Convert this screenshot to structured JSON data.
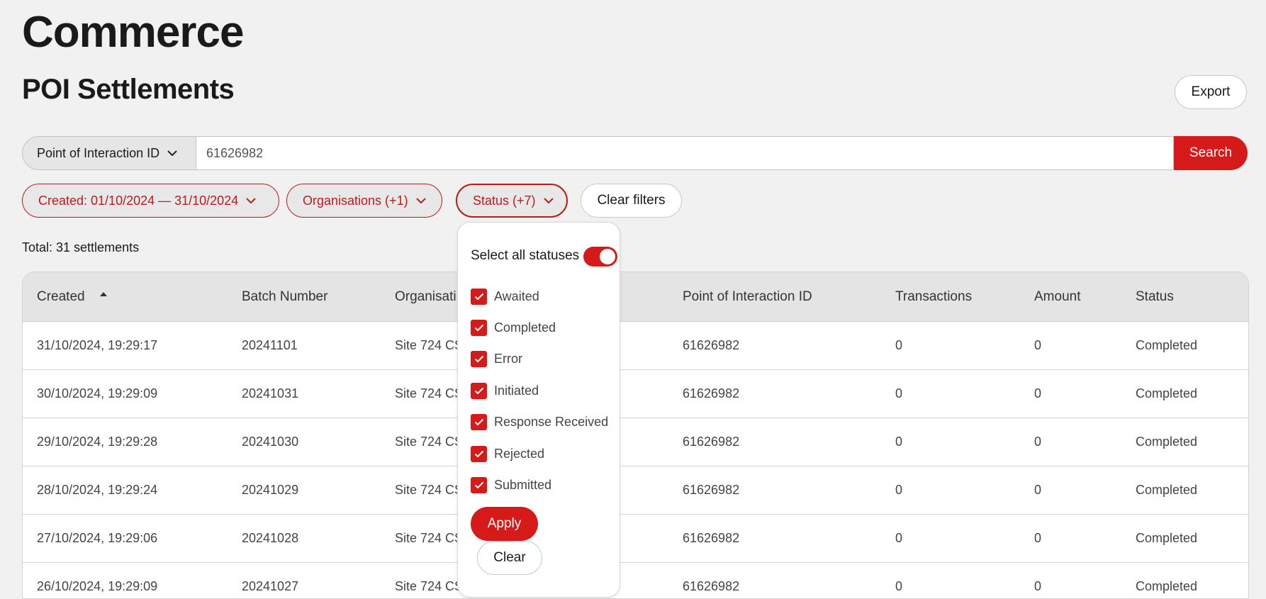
{
  "app": {
    "title": "Commerce"
  },
  "page": {
    "title": "POI Settlements",
    "export_label": "Export"
  },
  "search": {
    "field_label": "Point of Interaction ID",
    "value": "61626982",
    "button_label": "Search"
  },
  "filters": {
    "created_label": "Created: 01/10/2024 — 31/10/2024",
    "organisations_label": "Organisations (+1)",
    "status_label": "Status (+7)",
    "clear_label": "Clear filters"
  },
  "total_label": "Total: 31 settlements",
  "table": {
    "columns": [
      "Created",
      "Batch Number",
      "Organisati",
      "Point of Interaction ID",
      "Transactions",
      "Amount",
      "Status"
    ],
    "rows": [
      [
        "31/10/2024, 19:29:17",
        "20241101",
        "Site 724 CS",
        "61626982",
        "0",
        "0",
        "Completed"
      ],
      [
        "30/10/2024, 19:29:09",
        "20241031",
        "Site 724 CS",
        "61626982",
        "0",
        "0",
        "Completed"
      ],
      [
        "29/10/2024, 19:29:28",
        "20241030",
        "Site 724 CS",
        "61626982",
        "0",
        "0",
        "Completed"
      ],
      [
        "28/10/2024, 19:29:24",
        "20241029",
        "Site 724 CS",
        "61626982",
        "0",
        "0",
        "Completed"
      ],
      [
        "27/10/2024, 19:29:06",
        "20241028",
        "Site 724 CS",
        "61626982",
        "0",
        "0",
        "Completed"
      ],
      [
        "26/10/2024, 19:29:09",
        "20241027",
        "Site 724 CS",
        "61626982",
        "0",
        "0",
        "Completed"
      ]
    ]
  },
  "status_dropdown": {
    "select_all_label": "Select all statuses",
    "select_all_on": true,
    "options": [
      {
        "label": "Awaited",
        "checked": true
      },
      {
        "label": "Completed",
        "checked": true
      },
      {
        "label": "Error",
        "checked": true
      },
      {
        "label": "Initiated",
        "checked": true
      },
      {
        "label": "Response Received",
        "checked": true
      },
      {
        "label": "Rejected",
        "checked": true
      },
      {
        "label": "Submitted",
        "checked": true
      }
    ],
    "apply_label": "Apply",
    "clear_label": "Clear"
  },
  "colors": {
    "accent": "#d61a1a",
    "chip_text": "#b51c1c",
    "background": "#f1f1f1"
  },
  "icons": {
    "sort": "sort-ascending-icon",
    "chevron": "chevron-down-icon",
    "check": "check-icon"
  }
}
